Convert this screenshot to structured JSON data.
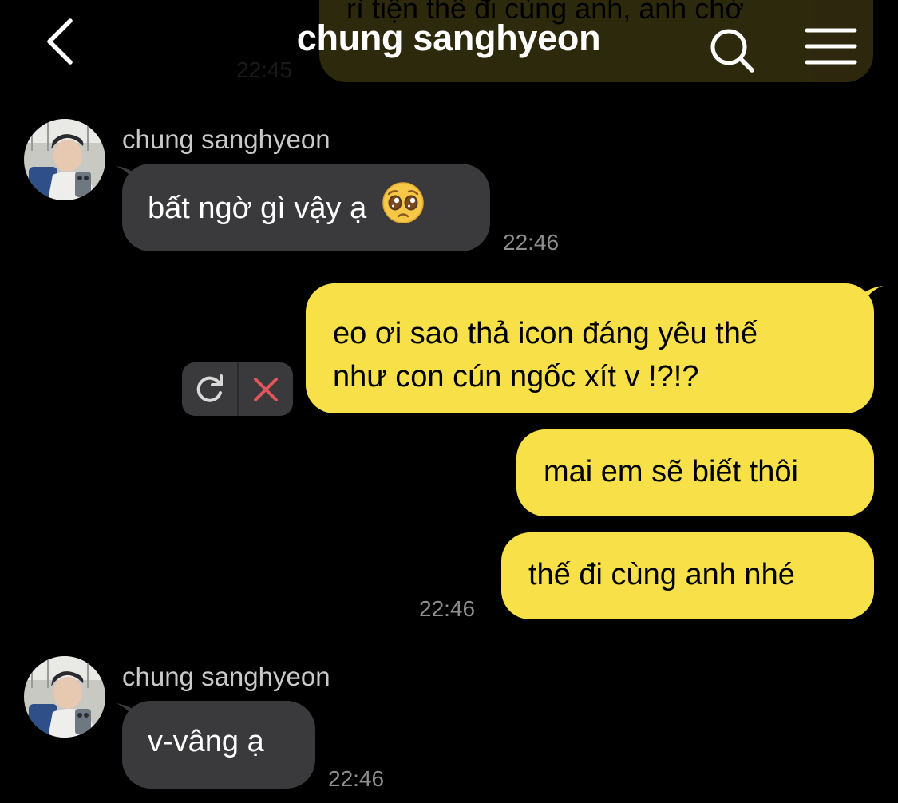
{
  "header": {
    "title": "chung sanghyeon"
  },
  "previous_message": {
    "text": "rì tiện thế đi cùng anh, anh chờ",
    "time": "22:45"
  },
  "messages": [
    {
      "direction": "incoming",
      "sender": "chung sanghyeon",
      "text": "bất ngờ gì vậy ạ",
      "emoji": "pleading-face",
      "time": "22:46"
    },
    {
      "direction": "outgoing",
      "lines": [
        "eo ơi sao thả icon đáng yêu thế",
        "như con cún ngốc xít v !?!?"
      ],
      "status": "failed"
    },
    {
      "direction": "outgoing",
      "text": "mai em sẽ biết thôi"
    },
    {
      "direction": "outgoing",
      "text": "thế đi cùng anh nhé",
      "time": "22:46"
    },
    {
      "direction": "incoming",
      "sender": "chung sanghyeon",
      "text": "v-vâng ạ",
      "time": "22:46"
    }
  ],
  "colors": {
    "background": "#000000",
    "incoming_bubble": "#3a3a3c",
    "outgoing_bubble": "#f7e048",
    "timestamp": "#8e8e8e",
    "cancel_x": "#e0565b"
  },
  "icons": {
    "back": "chevron-left-icon",
    "search": "search-icon",
    "menu": "hamburger-menu-icon",
    "retry": "refresh-icon",
    "cancel": "close-icon"
  }
}
